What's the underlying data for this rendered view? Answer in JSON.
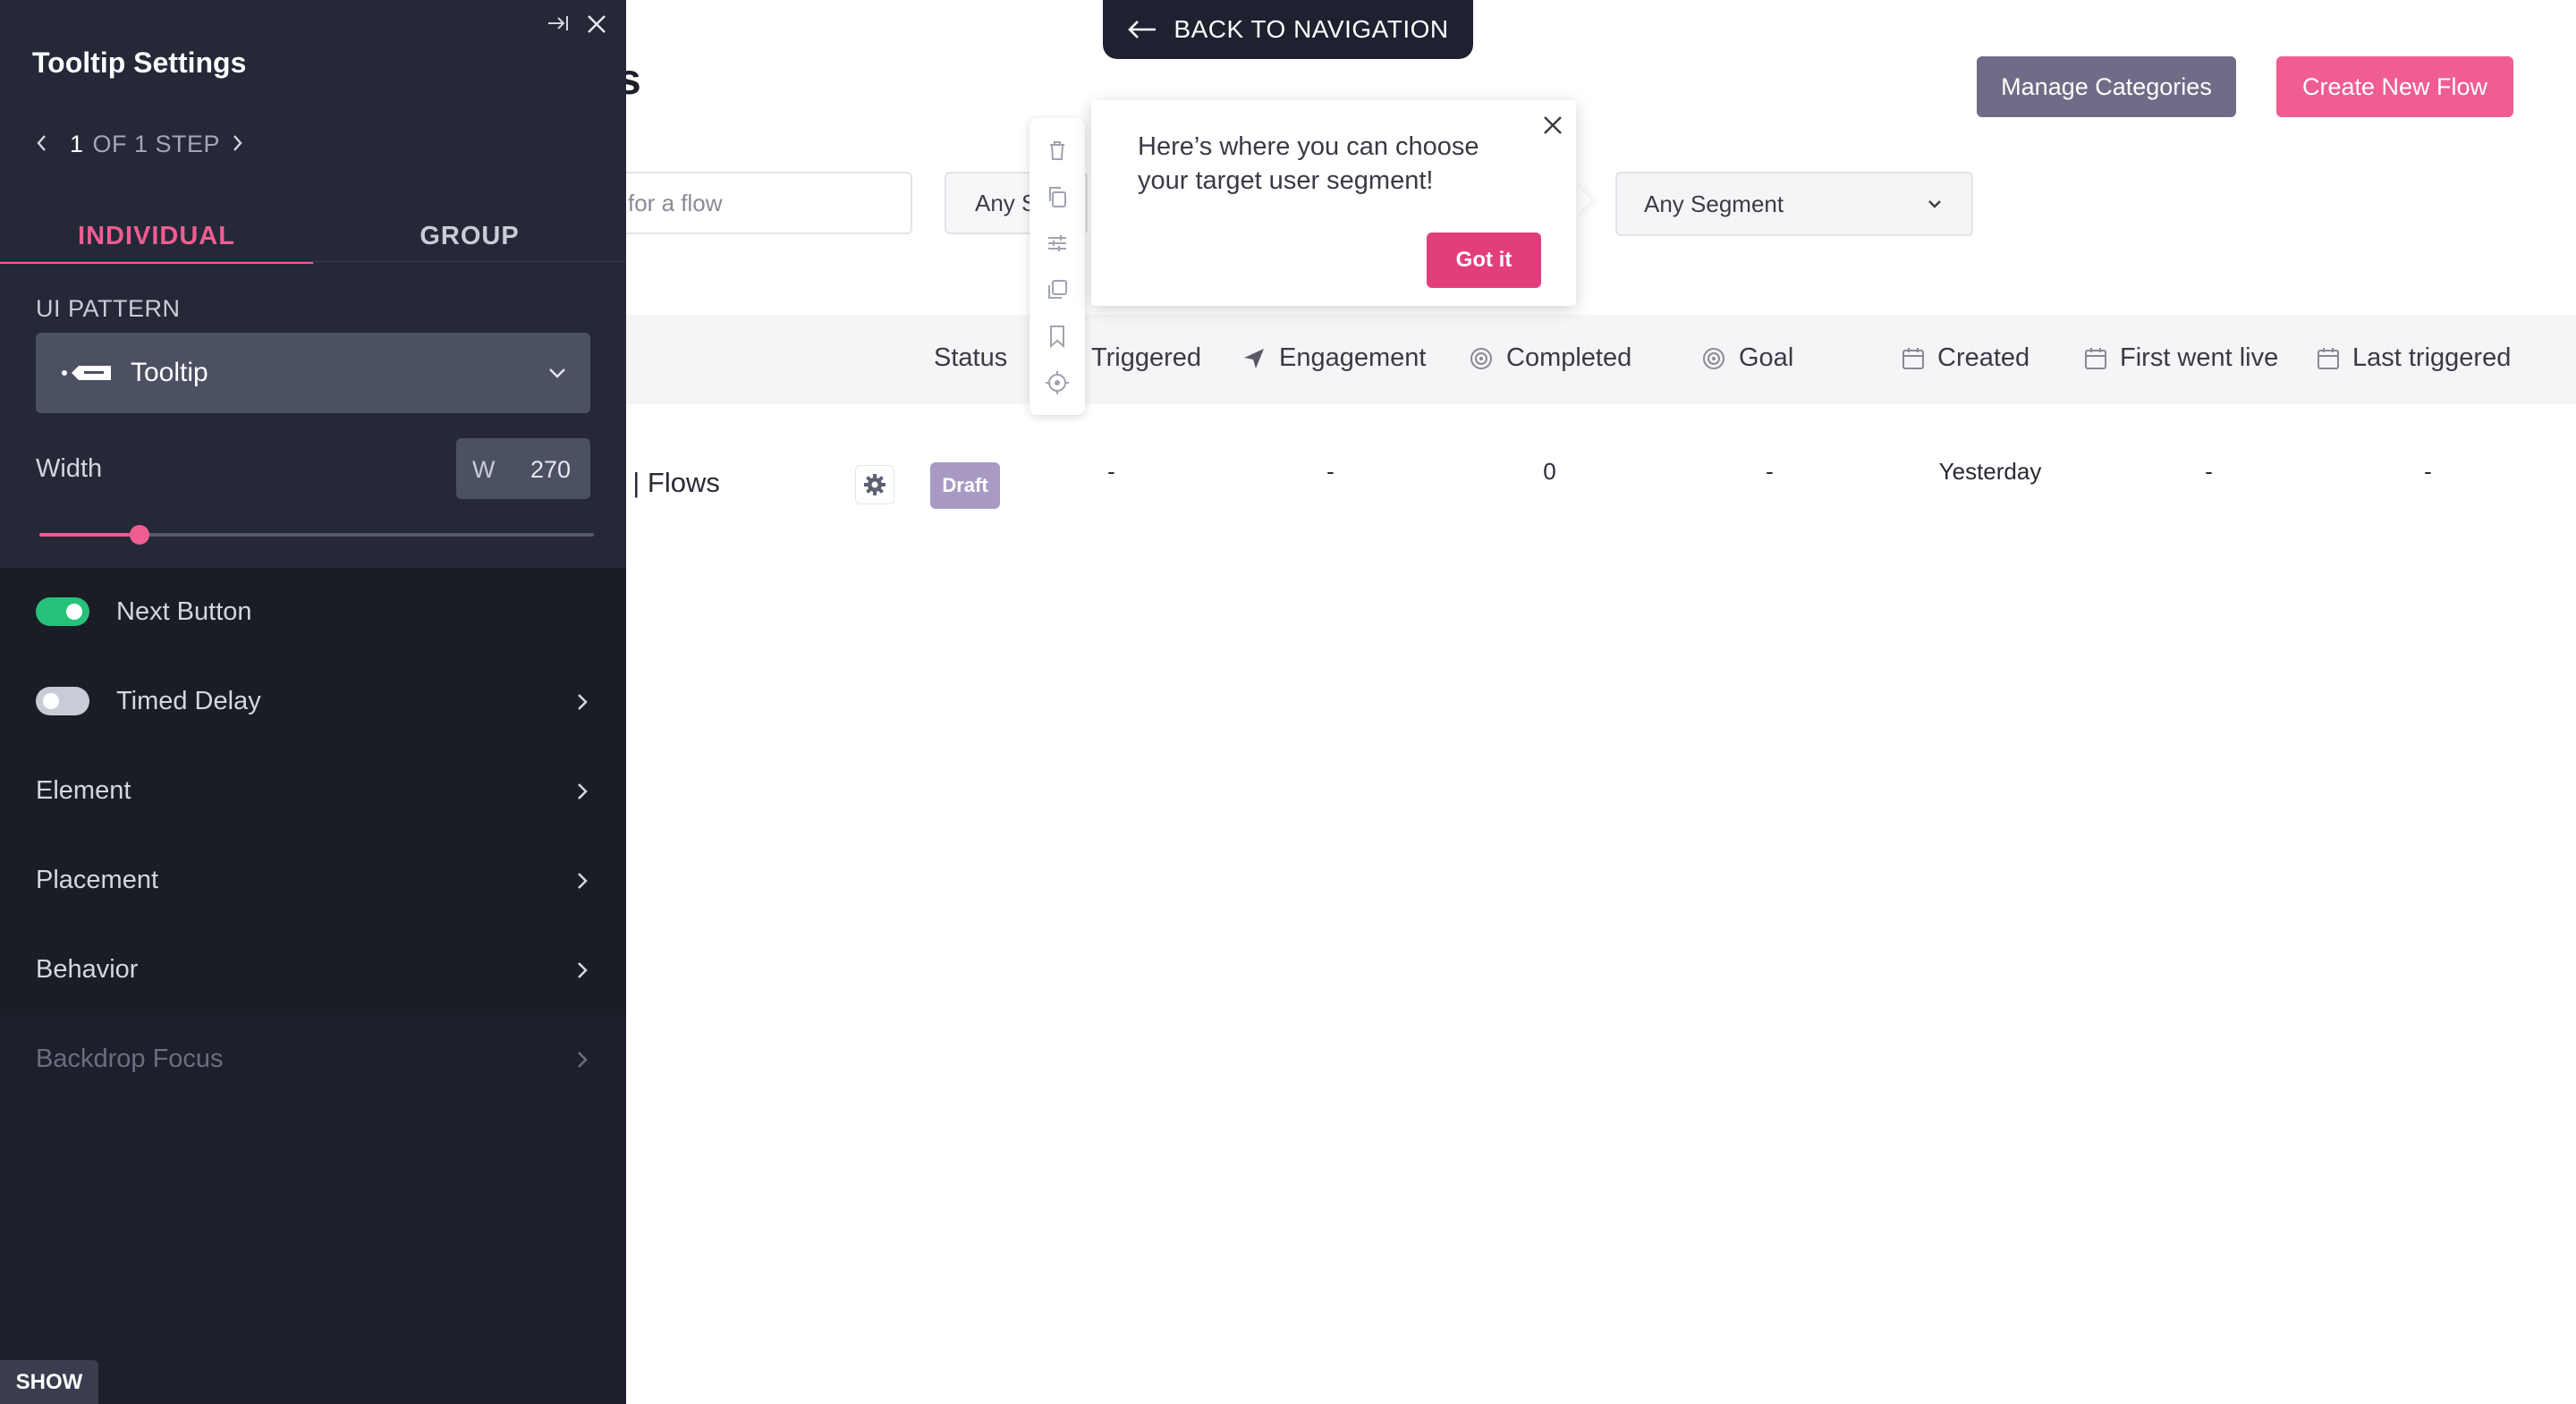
{
  "main": {
    "title_fragment": "s",
    "manage_categories_label": "Manage Categories",
    "create_new_flow_label": "Create New Flow",
    "search_placeholder": "for a flow",
    "status_filter_value": "Any S",
    "segment_filter_value": "Any Segment",
    "table": {
      "headers": {
        "status": "Status",
        "triggered": "Triggered",
        "engagement": "Engagement",
        "completed": "Completed",
        "goal": "Goal",
        "created": "Created",
        "first_went_live": "First went live",
        "last_triggered": "Last triggered"
      },
      "row": {
        "name": "t | Flows",
        "status": "Draft",
        "triggered": "-",
        "engagement": "-",
        "completed": "0",
        "goal": "-",
        "created": "Yesterday",
        "first_went_live": "-",
        "last_triggered": "-"
      }
    }
  },
  "back_nav": {
    "label": "BACK TO NAVIGATION"
  },
  "tooltip": {
    "text": "Here’s where you can choose your target user segment!",
    "button_label": "Got it"
  },
  "settings_panel": {
    "title": "Tooltip Settings",
    "step_current": "1",
    "step_suffix": "OF 1 STEP",
    "tabs": {
      "individual": "INDIVIDUAL",
      "group": "GROUP"
    },
    "ui_pattern_label": "UI PATTERN",
    "ui_pattern_value": "Tooltip",
    "width_label": "Width",
    "width_prefix": "W",
    "width_value": "270",
    "width_slider_fraction": 0.18,
    "next_button_label": "Next Button",
    "next_button_on": true,
    "timed_delay_label": "Timed Delay",
    "timed_delay_on": false,
    "element_label": "Element",
    "placement_label": "Placement",
    "behavior_label": "Behavior",
    "backdrop_focus_label": "Backdrop Focus",
    "show_label": "SHOW"
  },
  "colors": {
    "accent_pink": "#ef5d92",
    "panel_bg": "#1d202c",
    "toggle_on": "#27c27a",
    "manage_button": "#716b87",
    "draft_badge": "#a89ac4"
  }
}
